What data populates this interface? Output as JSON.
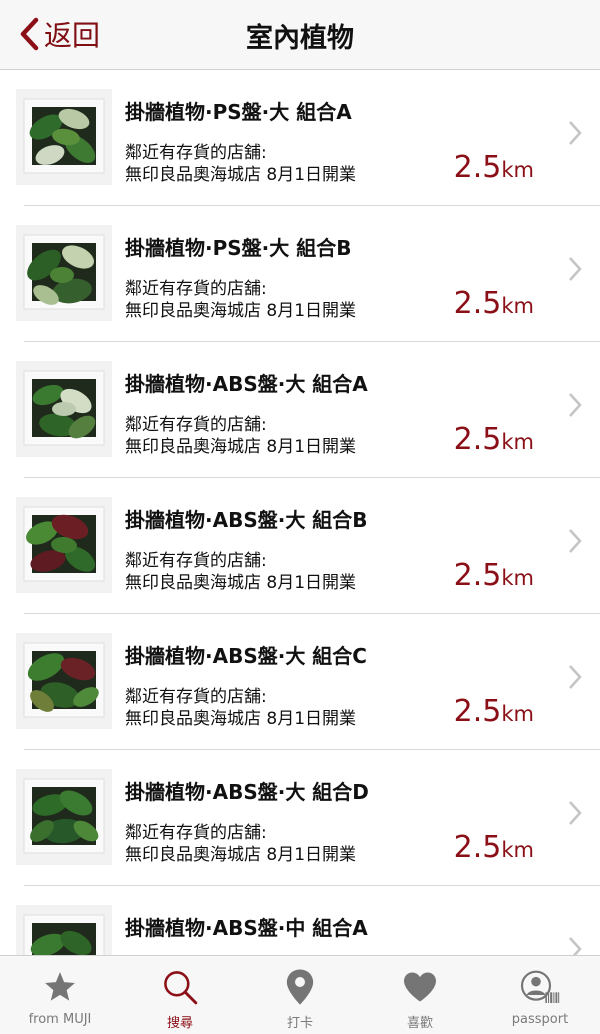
{
  "nav": {
    "back_label": "返回",
    "title": "室內植物"
  },
  "colors": {
    "accent": "#8b0f16",
    "inactive": "#7a7a7a"
  },
  "items": [
    {
      "name": "掛牆植物·PS盤·大 組合A",
      "stock_label": "鄰近有存貨的店舖:",
      "store": "無印良品奧海城店 8月1日開業",
      "distance": "2.5",
      "unit": "km"
    },
    {
      "name": "掛牆植物·PS盤·大 組合B",
      "stock_label": "鄰近有存貨的店舖:",
      "store": "無印良品奧海城店 8月1日開業",
      "distance": "2.5",
      "unit": "km"
    },
    {
      "name": "掛牆植物·ABS盤·大 組合A",
      "stock_label": "鄰近有存貨的店舖:",
      "store": "無印良品奧海城店 8月1日開業",
      "distance": "2.5",
      "unit": "km"
    },
    {
      "name": "掛牆植物·ABS盤·大 組合B",
      "stock_label": "鄰近有存貨的店舖:",
      "store": "無印良品奧海城店 8月1日開業",
      "distance": "2.5",
      "unit": "km"
    },
    {
      "name": "掛牆植物·ABS盤·大 組合C",
      "stock_label": "鄰近有存貨的店舖:",
      "store": "無印良品奧海城店 8月1日開業",
      "distance": "2.5",
      "unit": "km"
    },
    {
      "name": "掛牆植物·ABS盤·大 組合D",
      "stock_label": "鄰近有存貨的店舖:",
      "store": "無印良品奧海城店 8月1日開業",
      "distance": "2.5",
      "unit": "km"
    },
    {
      "name": "掛牆植物·ABS盤·中 組合A",
      "stock_label": "",
      "store": "",
      "distance": "",
      "unit": ""
    }
  ],
  "tabs": [
    {
      "label": "from MUJI",
      "icon": "star-icon",
      "active": false
    },
    {
      "label": "搜尋",
      "icon": "search-icon",
      "active": true
    },
    {
      "label": "打卡",
      "icon": "map-pin-icon",
      "active": false
    },
    {
      "label": "喜歡",
      "icon": "heart-icon",
      "active": false
    },
    {
      "label": "passport",
      "icon": "passport-icon",
      "active": false
    }
  ]
}
